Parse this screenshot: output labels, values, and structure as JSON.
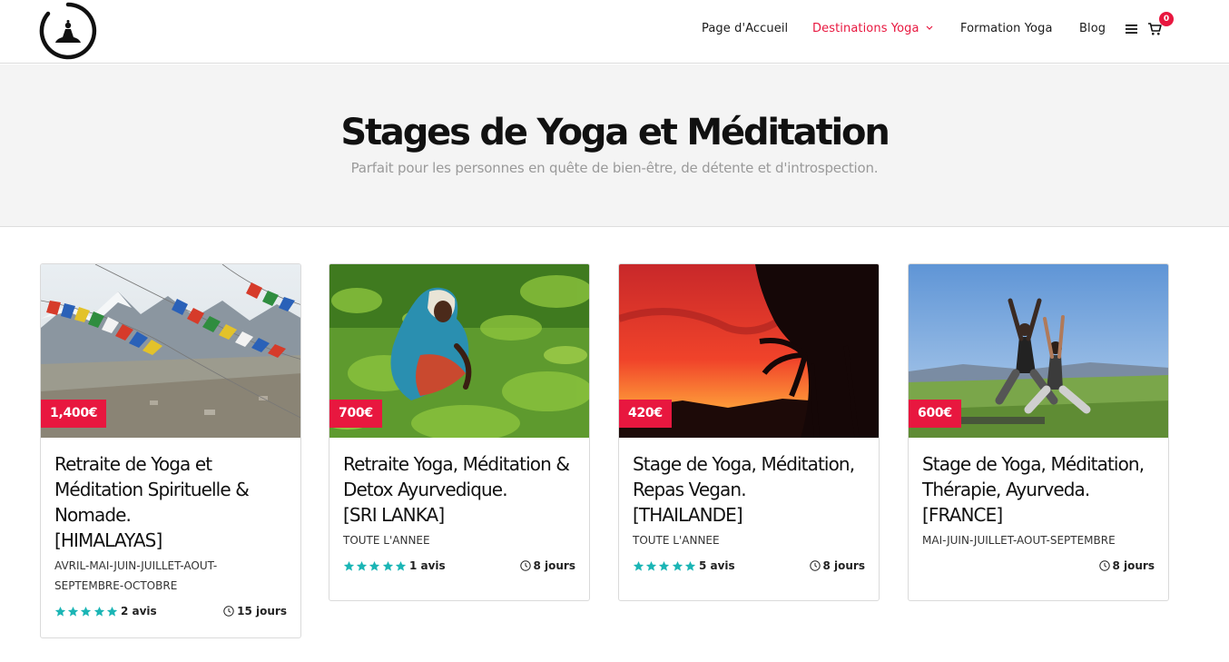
{
  "header": {
    "nav": [
      {
        "label": "Page d'Accueil",
        "active": false
      },
      {
        "label": "Destinations Yoga",
        "active": true
      },
      {
        "label": "Formation Yoga",
        "active": false
      },
      {
        "label": "Blog",
        "active": false
      }
    ],
    "cart_count": "0"
  },
  "hero": {
    "title": "Stages de Yoga et Méditation",
    "subtitle": "Parfait pour les personnes en quête de bien-être, de détente et d'introspection."
  },
  "colors": {
    "accent": "#e8173f",
    "stars": "#1bb5b5"
  },
  "retreats": [
    {
      "price": "1,400€",
      "title_lines": [
        "Retraite de Yoga et",
        "Méditation Spirituelle &",
        "Nomade.",
        "[HIMALAYAS]"
      ],
      "dates_lines": [
        "AVRIL-MAI-JUIN-JUILLET-AOUT-",
        "SEPTEMBRE-OCTOBRE"
      ],
      "rating": 5,
      "reviews": "2 avis",
      "duration": "15 jours"
    },
    {
      "price": "700€",
      "title_lines": [
        "Retraite Yoga, Méditation &",
        "Detox Ayurvedique.",
        "[SRI LANKA]"
      ],
      "dates_lines": [
        "TOUTE L'ANNEE"
      ],
      "rating": 5,
      "reviews": "1 avis",
      "duration": "8 jours"
    },
    {
      "price": "420€",
      "title_lines": [
        "Stage de Yoga, Méditation,",
        "Repas Vegan.",
        "[THAILANDE]"
      ],
      "dates_lines": [
        "TOUTE L'ANNEE"
      ],
      "rating": 5,
      "reviews": "5 avis",
      "duration": "8 jours"
    },
    {
      "price": "600€",
      "title_lines": [
        "Stage de Yoga, Méditation,",
        "Thérapie, Ayurveda.",
        "[FRANCE]"
      ],
      "dates_lines": [
        "MAI-JUIN-JUILLET-AOUT-SEPTEMBRE"
      ],
      "rating": null,
      "reviews": "",
      "duration": "8 jours"
    }
  ]
}
